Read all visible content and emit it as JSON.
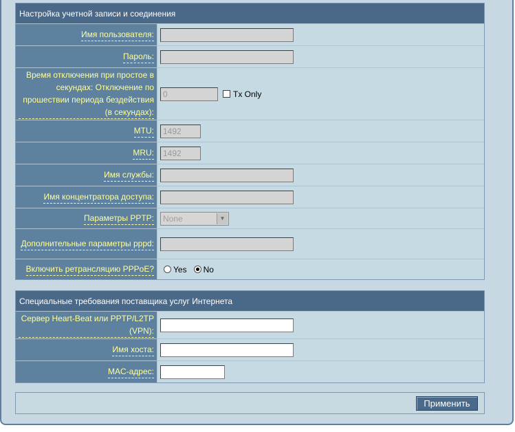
{
  "section1": {
    "title": "Настройка учетной записи и соединения",
    "username_label": "Имя пользователя:",
    "username_value": "",
    "password_label": "Пароль:",
    "password_value": "",
    "idle_label": "Время отключения при простое в секундах: Отключение по прошествии периода бездействия (в секундах):",
    "idle_value": "0",
    "txonly_label": "Tx Only",
    "mtu_label": "MTU:",
    "mtu_value": "1492",
    "mru_label": "MRU:",
    "mru_value": "1492",
    "service_label": "Имя службы:",
    "service_value": "",
    "ac_label": "Имя концентратора доступа:",
    "ac_value": "",
    "pptp_label": "Параметры PPTP:",
    "pptp_value": "None",
    "pppd_label": "Дополнительные параметры pppd:",
    "pppd_value": "",
    "relay_label": "Включить ретрансляцию PPPoE?",
    "relay_yes": "Yes",
    "relay_no": "No",
    "relay_selected": "No"
  },
  "section2": {
    "title": "Специальные требования поставщика услуг Интернета",
    "heartbeat_label": "Сервер Heart-Beat или PPTP/L2TP (VPN):",
    "heartbeat_value": "",
    "host_label": "Имя хоста:",
    "host_value": "",
    "mac_label": "MAC-адрес:",
    "mac_value": ""
  },
  "apply_label": "Применить"
}
